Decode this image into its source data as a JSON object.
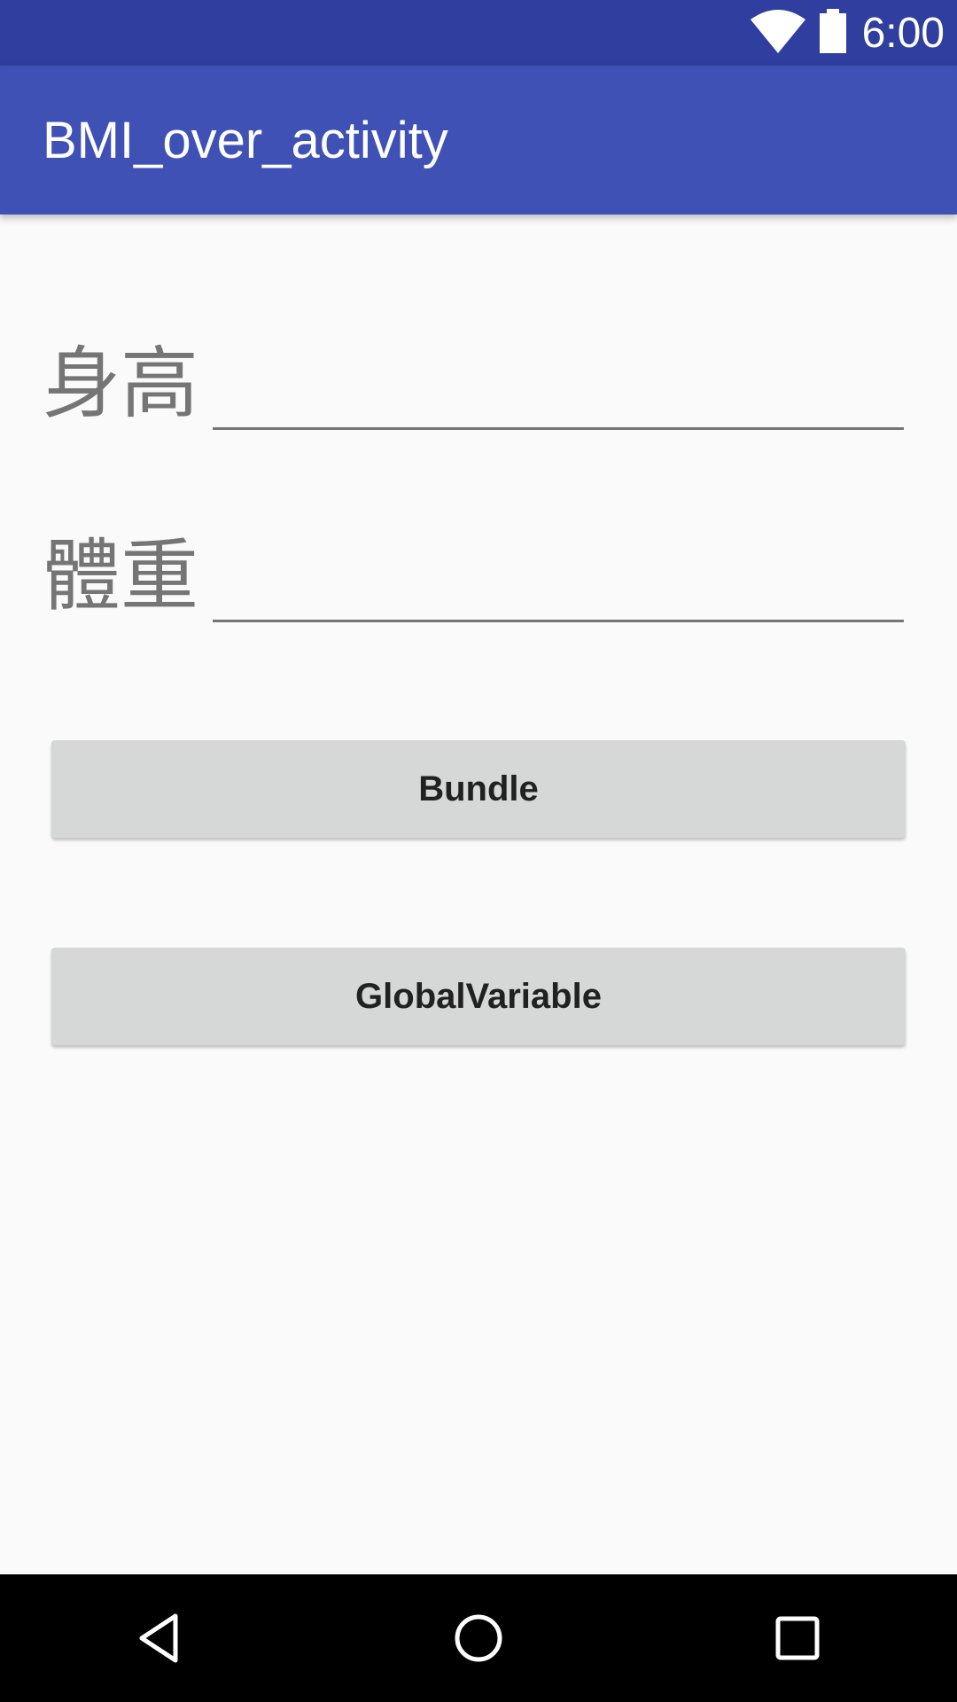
{
  "status_bar": {
    "time": "6:00",
    "wifi_icon": "wifi-icon",
    "battery_icon": "battery-icon"
  },
  "app_bar": {
    "title": "BMI_over_activity",
    "color": "#3F51B5"
  },
  "form": {
    "height_label": "身高",
    "height_value": "",
    "weight_label": "體重",
    "weight_value": ""
  },
  "buttons": {
    "bundle_label": "Bundle",
    "global_label": "GlobalVariable"
  },
  "nav_bar": {
    "back_icon": "back-icon",
    "home_icon": "home-icon",
    "recents_icon": "recents-icon"
  },
  "colors": {
    "status_bar": "#303F9F",
    "primary": "#3F51B5",
    "background": "#FAFAFA",
    "button": "#D6D7D7"
  }
}
